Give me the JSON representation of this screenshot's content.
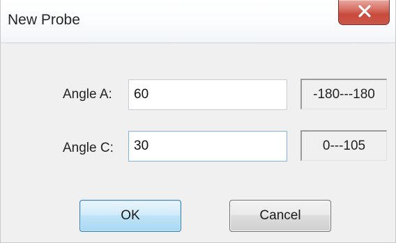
{
  "window": {
    "title": "New Probe",
    "close_icon": "close-icon"
  },
  "form": {
    "angle_a": {
      "label": "Angle A:",
      "value": "60",
      "range": "-180---180"
    },
    "angle_c": {
      "label": "Angle C:",
      "value": "30",
      "range": "0---105"
    }
  },
  "buttons": {
    "ok_label": "OK",
    "cancel_label": "Cancel"
  },
  "colors": {
    "close_button": "#c94a3d",
    "ok_button": "#bfe3f7",
    "focus_border": "#7eb4ea"
  }
}
